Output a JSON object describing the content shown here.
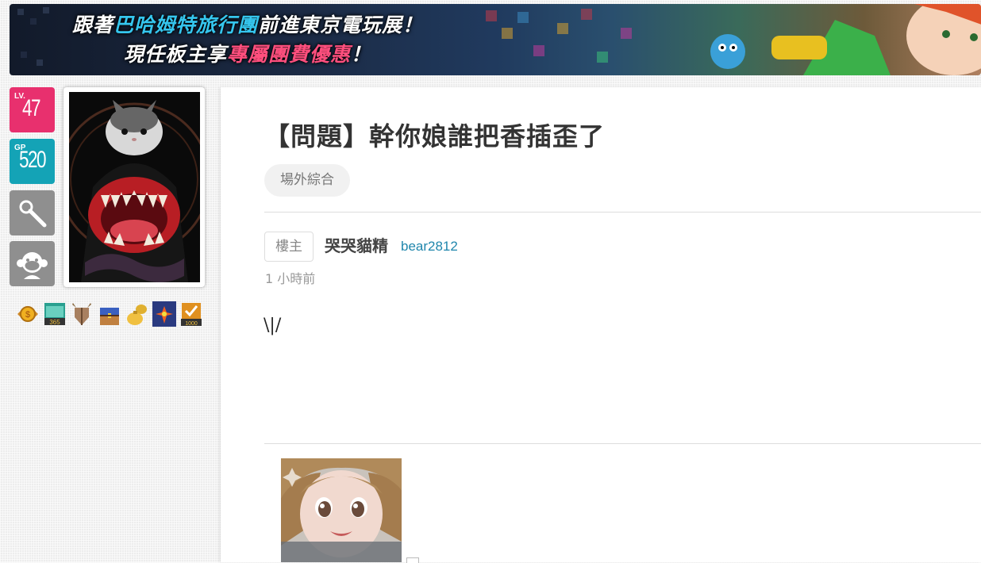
{
  "banner": {
    "line1_a": "跟著",
    "line1_b": "巴哈姆特旅行團",
    "line1_c": "前進東京電玩展！",
    "line2_a": "現任板主享",
    "line2_b": "專屬團費優惠",
    "line2_c": "！",
    "highlight_blue": "#35c6ee",
    "highlight_pink": "#ff4f7e"
  },
  "sidebar": {
    "level_label": "LV.",
    "level": "47",
    "gp_label": "GP",
    "gp": "520",
    "icons": [
      "magnifier-icon",
      "monkey-icon"
    ],
    "level_color": "#e8306e",
    "gp_color": "#14a3b6",
    "badges": [
      "coin-badge",
      "calendar-365-badge",
      "shield-badge",
      "treasure-chest-badge",
      "money-bag-badge",
      "fireworks-badge",
      "checkmark-1000-badge"
    ],
    "badge_texts": {
      "calendar": "365",
      "checkmark": "1000"
    }
  },
  "post": {
    "title": "【問題】幹你娘誰把香插歪了",
    "board": "場外綜合",
    "floor": "樓主",
    "author_name": "哭哭貓精",
    "author_id": "bear2812",
    "time": "1 小時前",
    "body": "\\|/"
  }
}
